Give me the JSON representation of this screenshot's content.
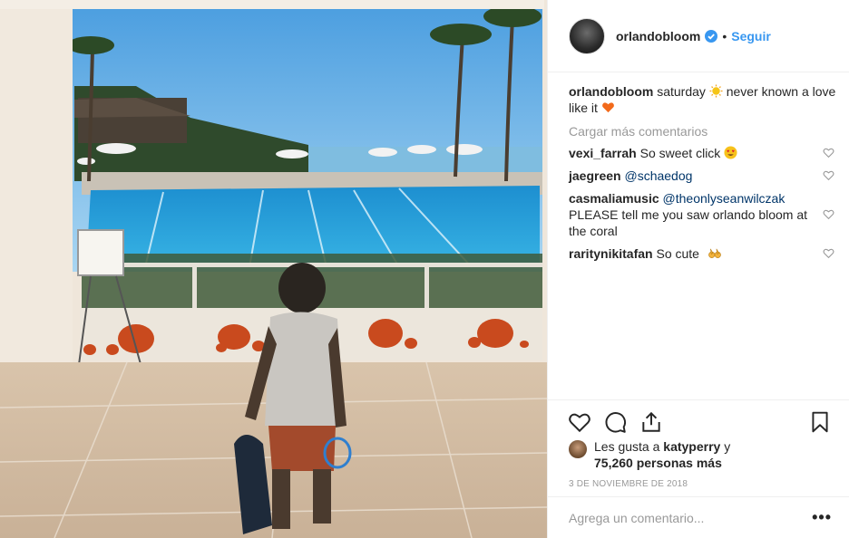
{
  "post": {
    "author": "orlandobloom",
    "follow_label": "Seguir",
    "dot": "•",
    "caption_text_1": "saturday",
    "caption_text_2": "never known a love like it",
    "load_more": "Cargar más comentarios",
    "comments": [
      {
        "user": "vexi_farrah",
        "text": "So sweet click"
      },
      {
        "user": "jaegreen",
        "mention": "@schaedog"
      },
      {
        "user": "casmaliamusic",
        "mention": "@theonlyseanwilczak",
        "text": "PLEASE tell me you saw orlando bloom at the coral"
      },
      {
        "user": "raritynikitafan",
        "text": "So cute"
      }
    ],
    "likes_prefix": "Les gusta a",
    "likes_user": "katyperry",
    "likes_suffix": "y",
    "likes_count": "75,260 personas más",
    "date": "3 DE NOVIEMBRE DE 2018",
    "add_comment_placeholder": "Agrega un comentario...",
    "more_label": "•••"
  },
  "icons": {
    "verified": "verified-badge-icon",
    "heart": "heart-icon",
    "comment": "comment-icon",
    "share": "share-icon",
    "bookmark": "bookmark-icon"
  },
  "colors": {
    "follow": "#3897f0",
    "mention": "#003569",
    "muted": "#999999",
    "border": "#efefef"
  }
}
